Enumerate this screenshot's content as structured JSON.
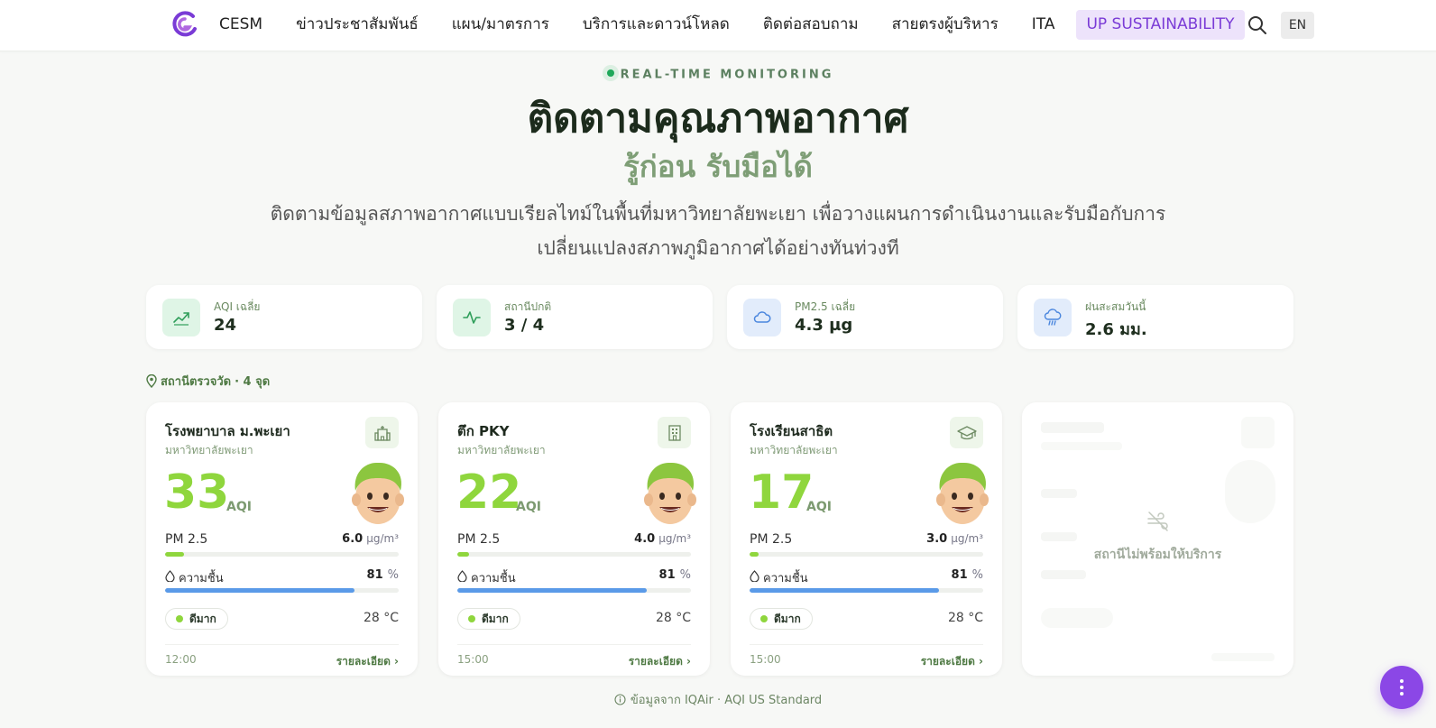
{
  "nav": {
    "items": [
      {
        "label": "CESM"
      },
      {
        "label": "ข่าวประชาสัมพันธ์"
      },
      {
        "label": "แผน/มาตรการ"
      },
      {
        "label": "บริการและดาวน์โหลด"
      },
      {
        "label": "ติดต่อสอบถาม"
      },
      {
        "label": "สายตรงผู้บริหาร"
      },
      {
        "label": "ITA"
      },
      {
        "label": "UP SUSTAINABILITY"
      }
    ],
    "lang": "EN"
  },
  "hero": {
    "eyebrow": "REAL-TIME MONITORING",
    "title": "ติดตามคุณภาพอากาศ",
    "subtitle": "รู้ก่อน รับมือได้",
    "description_line1": "ติดตามข้อมูลสภาพอากาศแบบเรียลไทม์ในพื้นที่มหาวิทยาลัยพะเยา เพื่อวางแผนการดำเนินงานและรับมือกับการ",
    "description_line2": "เปลี่ยนแปลงสภาพภูมิอากาศได้อย่างทันท่วงที"
  },
  "stats": [
    {
      "label": "AQI เฉลี่ย",
      "value": "24",
      "icon": "trend-up-icon",
      "color": "#dff5e6"
    },
    {
      "label": "สถานีปกติ",
      "value": "3 / 4",
      "icon": "pulse-icon",
      "color": "#dff5e6"
    },
    {
      "label": "PM2.5 เฉลี่ย",
      "value": "4.3 µg",
      "icon": "cloud-icon",
      "color": "#e2ecfb"
    },
    {
      "label": "ฝนสะสมวันนี้",
      "value": "2.6 มม.",
      "icon": "rain-cloud-icon",
      "color": "#e2ecfb"
    }
  ],
  "stations_header": {
    "label": "สถานีตรวจวัด",
    "count": "· 4 จุด"
  },
  "cards": [
    {
      "name": "โรงพยาบาล ม.พะเยา",
      "sub": "มหาวิทยาลัยพะเยา",
      "aqi": "33",
      "aqi_unit": "AQI",
      "pm_label": "PM 2.5",
      "pm": "6.0",
      "pm_unit": "µg/m³",
      "pm_pct": 0.08,
      "hum_label": "ความชื้น",
      "hum": "81",
      "hum_unit": "%",
      "hum_pct": 0.81,
      "status": "ดีมาก",
      "temp": "28 °C",
      "time": "12:00",
      "link": "รายละเอียด ›",
      "icon": "hospital-icon"
    },
    {
      "name": "ตึก PKY",
      "sub": "มหาวิทยาลัยพะเยา",
      "aqi": "22",
      "aqi_unit": "AQI",
      "pm_label": "PM 2.5",
      "pm": "4.0",
      "pm_unit": "µg/m³",
      "pm_pct": 0.05,
      "hum_label": "ความชื้น",
      "hum": "81",
      "hum_unit": "%",
      "hum_pct": 0.81,
      "status": "ดีมาก",
      "temp": "28 °C",
      "time": "15:00",
      "link": "รายละเอียด ›",
      "icon": "building-icon"
    },
    {
      "name": "โรงเรียนสาธิต",
      "sub": "มหาวิทยาลัยพะเยา",
      "aqi": "17",
      "aqi_unit": "AQI",
      "pm_label": "PM 2.5",
      "pm": "3.0",
      "pm_unit": "µg/m³",
      "pm_pct": 0.04,
      "hum_label": "ความชื้น",
      "hum": "81",
      "hum_unit": "%",
      "hum_pct": 0.81,
      "status": "ดีมาก",
      "temp": "28 °C",
      "time": "15:00",
      "link": "รายละเอียด ›",
      "icon": "graduation-cap-icon"
    }
  ],
  "offline_card": {
    "message": "สถานีไม่พร้อมให้บริการ"
  },
  "footer": {
    "note": "ข้อมูลจาก IQAir · AQI US Standard"
  },
  "colors": {
    "accent": "#8b47e6",
    "aqi_good": "#8fd63d",
    "humidity": "#5a9ae8",
    "brand_green": "#4f7a44"
  }
}
